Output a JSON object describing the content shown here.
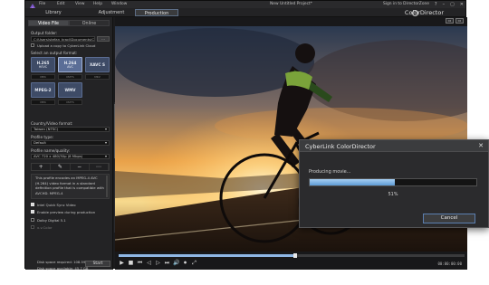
{
  "menu": [
    "File",
    "Edit",
    "View",
    "Help",
    "Window"
  ],
  "window_title": "New Untitled Project*",
  "help_link": "Sign in to DirectorZone",
  "window_controls": [
    "?",
    "–",
    "▢",
    "✕"
  ],
  "modes": [
    "Library",
    "Adjustment",
    "Production"
  ],
  "active_mode": "Production",
  "brand": "ColorDirector",
  "left": {
    "tabs": [
      "Video File",
      "Online"
    ],
    "output_folder_label": "Output folder:",
    "output_folder_value": "C:\\Users\\stefan_kracl\\Documents\\Cyb...",
    "browse": "...",
    "upload_cloud": "Upload a copy to CyberLink Cloud",
    "select_format": "Select an output format:",
    "formats": [
      {
        "name": "H.265",
        "sub": "HEVC"
      },
      {
        "name": "H.264",
        "sub": "AVC"
      },
      {
        "name": "XAVC S",
        "sub": ""
      },
      {
        "name": "MPEG-2",
        "sub": ""
      },
      {
        "name": "WMV",
        "sub": ""
      }
    ],
    "selected_format": "H.264 AVC",
    "mini_dropdowns": [
      "MP4",
      "M2TS",
      "MKV",
      "MP4",
      "M2TS"
    ],
    "country_label": "Country/Video format:",
    "country_value": "Taiwan (NTSC)",
    "profile_type_label": "Profile type:",
    "profile_type_value": "Default",
    "profile_quality_label": "Profile name/quality:",
    "profile_quality_value": "AVC 720 x 480/30p (8 Mbps)",
    "profile_icons": [
      "+",
      "✎",
      "−",
      "⋯"
    ],
    "description": "This profile encodes an MPEG-4 AVC (H.264) video format in a standard definition profile that is compatible with AVCHD. MPEG-4",
    "options": [
      {
        "label": "Intel Quick Sync Video",
        "checked": true
      },
      {
        "label": "Enable preview during production",
        "checked": true
      },
      {
        "label": "Dolby Digital 5.1",
        "checked": false
      },
      {
        "label": "x.v.Color",
        "checked": false
      }
    ],
    "disk_required": "Disk space required: 108.59 MB",
    "disk_available": "Disk space available: 45.7 GB",
    "start": "Start"
  },
  "player": {
    "progress_fraction": 0.51,
    "controls": [
      "▶",
      "■",
      "⏮",
      "◁",
      "▷",
      "⏭",
      "🔊",
      "⏺",
      "⤢"
    ],
    "timecode": "00:00:00:00",
    "view_icons": [
      "▭",
      "▭"
    ]
  },
  "dialog": {
    "title": "CyberLink ColorDirector",
    "status": "Producing movie...",
    "progress": 51,
    "percent_label": "51%",
    "cancel": "Cancel"
  }
}
